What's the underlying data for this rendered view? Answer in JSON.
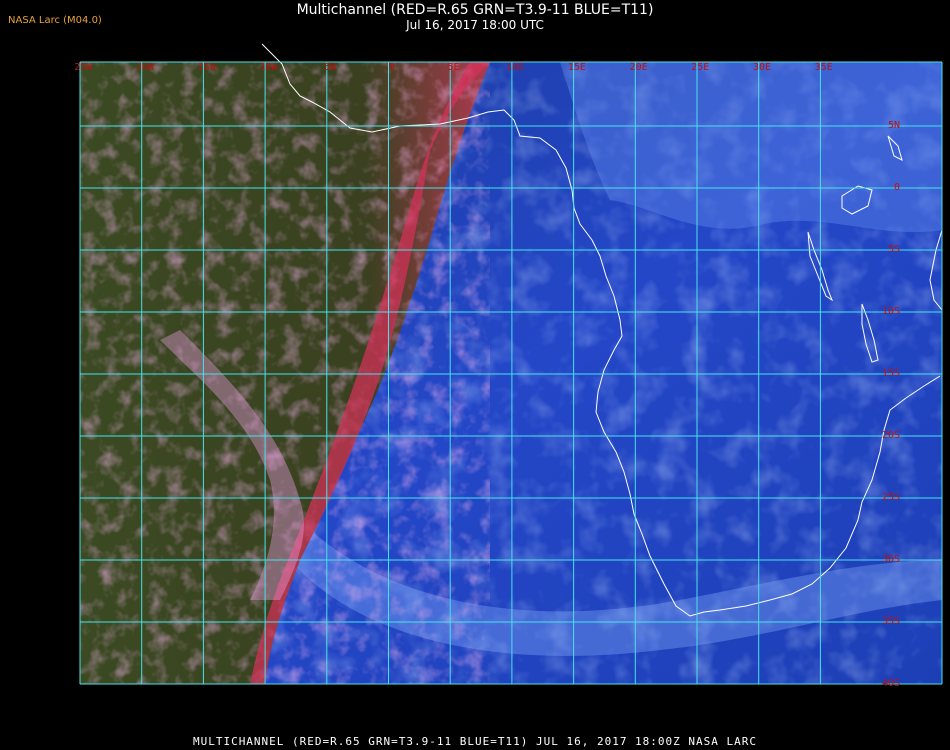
{
  "header": {
    "credit": "NASA Larc (M04.0)",
    "title": "Multichannel (RED=R.65 GRN=T3.9-11 BLUE=T11)",
    "subtitle": "Jul 16, 2017 18:00 UTC"
  },
  "footer": {
    "text": "MULTICHANNEL (RED=R.65 GRN=T3.9-11 BLUE=T11) JUL 16, 2017 18:00Z   NASA LARC"
  },
  "map": {
    "longitude_labels": [
      "25W",
      "20W",
      "15W",
      "10W",
      "5W",
      "0",
      "5E",
      "10E",
      "15E",
      "20E",
      "25E",
      "30E",
      "35E"
    ],
    "latitude_labels": [
      "5N",
      "0",
      "5S",
      "10S",
      "15S",
      "20S",
      "25S",
      "30S",
      "35S",
      "40S"
    ],
    "colors": {
      "grid": "#44e4ec",
      "label": "#c01010",
      "coast": "#ffffff",
      "land_day": "#2d4a1c",
      "ocean_day": "#c83a5e",
      "ocean_night": "#1e3fc0",
      "cloud_day": "#e070d8",
      "cloud_night": "#7ea8ff"
    }
  }
}
